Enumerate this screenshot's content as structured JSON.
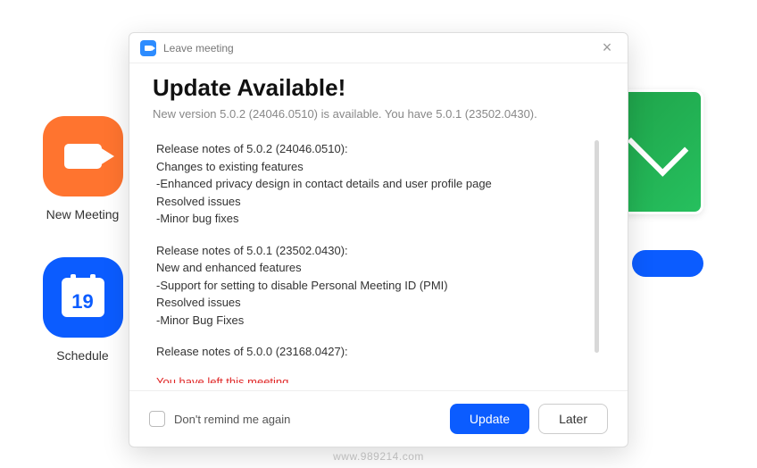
{
  "background": {
    "tiles": [
      {
        "label": "New Meeting",
        "cal_day": ""
      },
      {
        "label": "",
        "cal_day": ""
      },
      {
        "label": "Schedule",
        "cal_day": "19"
      },
      {
        "label": "",
        "cal_day": ""
      }
    ]
  },
  "dialog": {
    "title": "Leave meeting",
    "heading": "Update Available!",
    "subheading": "New version 5.0.2 (24046.0510) is available. You have 5.0.1 (23502.0430).",
    "notes": [
      {
        "header": "Release notes of 5.0.2 (24046.0510):",
        "lines": [
          "Changes to existing features",
          "-Enhanced privacy design in contact details and user profile page",
          "Resolved issues",
          "-Minor bug fixes"
        ]
      },
      {
        "header": "Release notes of 5.0.1 (23502.0430):",
        "lines": [
          "New and enhanced features",
          "-Support for setting to disable Personal Meeting ID (PMI)",
          "Resolved issues",
          "-Minor Bug Fixes"
        ]
      },
      {
        "header": "Release notes of 5.0.0 (23168.0427):",
        "lines": []
      }
    ],
    "left_message": "You have left this meeting.",
    "checkbox_label": "Don't remind me again",
    "update_label": "Update",
    "later_label": "Later"
  },
  "watermark": "www.989214.com"
}
